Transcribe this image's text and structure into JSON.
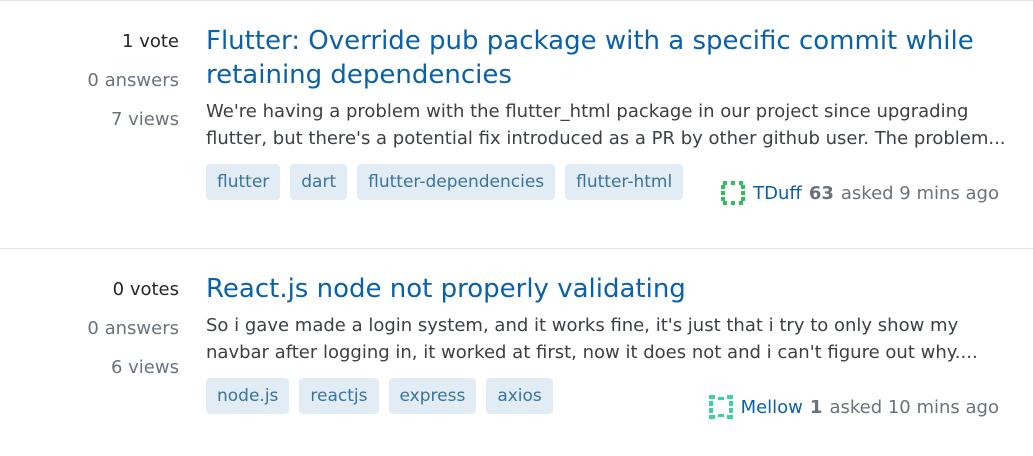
{
  "questions": [
    {
      "votes": "1 vote",
      "answers": "0 answers",
      "views": "7 views",
      "title": "Flutter: Override pub package with a specific commit while retaining dependencies",
      "excerpt": "We're having a problem with the flutter_html package in our project since upgrading flutter, but there's a potential fix introduced as a PR by other github user. The problem...",
      "tags": [
        "flutter",
        "dart",
        "flutter-dependencies",
        "flutter-html"
      ],
      "user": {
        "name": "TDuff",
        "reputation": "63",
        "asked": "asked 9 mins ago"
      }
    },
    {
      "votes": "0 votes",
      "answers": "0 answers",
      "views": "6 views",
      "title": "React.js node not properly validating",
      "excerpt": "So i gave made a login system, and it works fine, it's just that i try to only show my navbar after logging in, it worked at first, now it does not and i can't figure out why....",
      "tags": [
        "node.js",
        "reactjs",
        "express",
        "axios"
      ],
      "user": {
        "name": "Mellow",
        "reputation": "1",
        "asked": "asked 10 mins ago"
      }
    }
  ],
  "colors": {
    "link": "#0a61a8",
    "tag_bg": "#e1ecf4",
    "tag_text": "#39739d",
    "avatar_green": "#2fbf5a",
    "avatar_teal": "#3fd0a8"
  },
  "icons": {
    "avatar": "identicon-avatar"
  }
}
